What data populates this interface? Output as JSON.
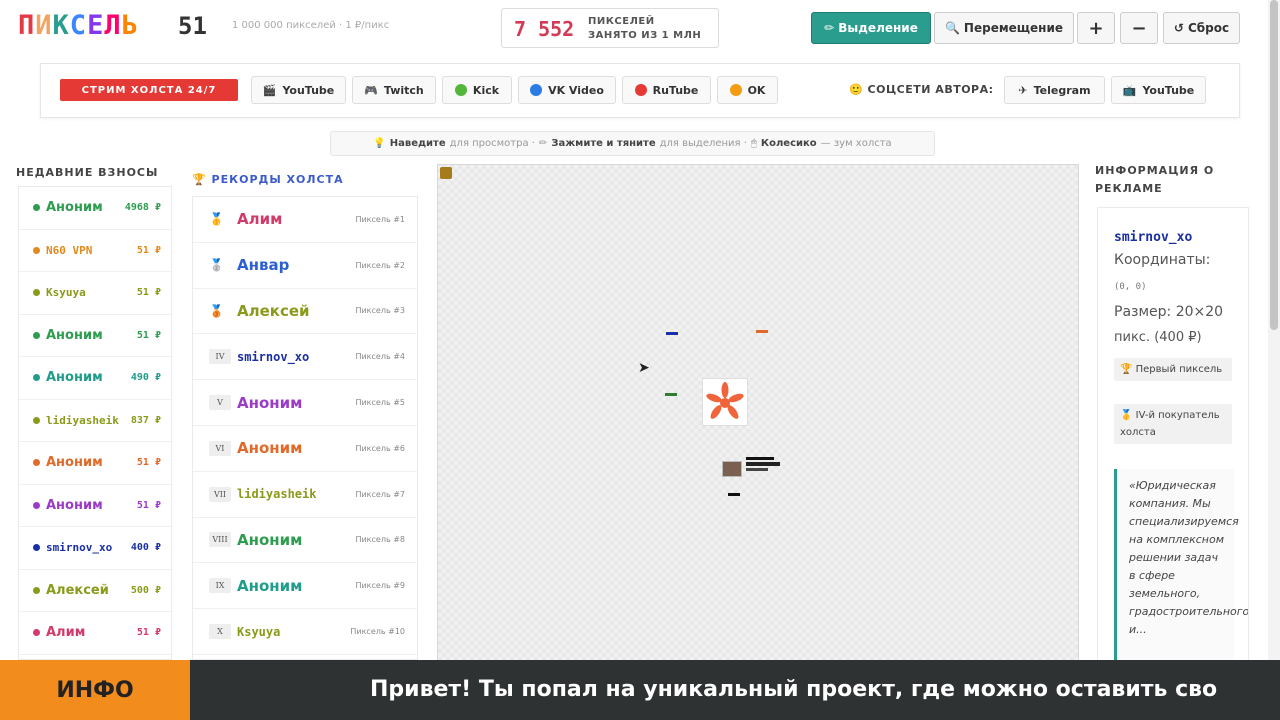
{
  "header": {
    "logo_letters": [
      {
        "ch": "П",
        "color": "#e63946"
      },
      {
        "ch": "И",
        "color": "#f4a261"
      },
      {
        "ch": "К",
        "color": "#2a9d8f"
      },
      {
        "ch": "С",
        "color": "#3a86ff"
      },
      {
        "ch": "Е",
        "color": "#8338ec"
      },
      {
        "ch": "Л",
        "color": "#ff006e"
      },
      {
        "ch": "Ь",
        "color": "#fb8500"
      }
    ],
    "logo_number": "51",
    "subtitle": "1 000 000 пикселей · 1 ₽/пикс",
    "counter_value": "7 552",
    "counter_label_line1": "ПИКСЕЛЕЙ",
    "counter_label_line2": "ЗАНЯТО ИЗ 1 МЛН",
    "tools": {
      "select_label": "Выделение",
      "move_label": "Перемещение",
      "zoom_in_label": "+",
      "zoom_out_label": "−",
      "reset_label": "Сброс"
    }
  },
  "streams": {
    "live_label": "СТРИМ ХОЛСТА 24/7",
    "platforms": [
      {
        "label": "YouTube",
        "icon": "film-icon"
      },
      {
        "label": "Twitch",
        "icon": "gamepad-icon"
      },
      {
        "label": "Kick",
        "icon": "green-dot",
        "color": "#53b53a"
      },
      {
        "label": "VK Video",
        "icon": "blue-dot",
        "color": "#2c7be5"
      },
      {
        "label": "RuTube",
        "icon": "red-dot",
        "color": "#e53935"
      },
      {
        "label": "OK",
        "icon": "orange-dot",
        "color": "#f39c12"
      }
    ],
    "author_label": "СОЦСЕТИ АВТОРА:",
    "author_links": [
      {
        "label": "Telegram",
        "icon": "plane-icon"
      },
      {
        "label": "YouTube",
        "icon": "tv-icon"
      }
    ]
  },
  "hint": {
    "hover_bold": "Наведите",
    "hover_text": "для просмотра ·",
    "drag_bold": "Зажмите и тяните",
    "drag_text": "для выделения ·",
    "wheel_bold": "Колесико",
    "wheel_text": "— зум холста"
  },
  "recent": {
    "title": "НЕДАВНИЕ ВЗНОСЫ",
    "items": [
      {
        "name": "Аноним",
        "amount": "4968 ₽",
        "color": "#2e9d4f"
      },
      {
        "name": "N60 VPN",
        "amount": "51 ₽",
        "color": "#e08a1e"
      },
      {
        "name": "Ksyuya",
        "amount": "51 ₽",
        "color": "#8a9a1a"
      },
      {
        "name": "Аноним",
        "amount": "51 ₽",
        "color": "#2e9d4f"
      },
      {
        "name": "Аноним",
        "amount": "490 ₽",
        "color": "#1f9d8a"
      },
      {
        "name": "lidiyasheik",
        "amount": "837 ₽",
        "color": "#8a9a1a"
      },
      {
        "name": "Аноним",
        "amount": "51 ₽",
        "color": "#e06a2a"
      },
      {
        "name": "Аноним",
        "amount": "51 ₽",
        "color": "#9b3cc9"
      },
      {
        "name": "smirnov_xo",
        "amount": "400 ₽",
        "color": "#1a2fa3"
      },
      {
        "name": "Алексей",
        "amount": "500 ₽",
        "color": "#8a9a1a"
      },
      {
        "name": "Алим",
        "amount": "51 ₽",
        "color": "#d23a6a"
      }
    ]
  },
  "records": {
    "title": "РЕКОРДЫ ХОЛСТА",
    "items": [
      {
        "rank": "🥇",
        "roman": false,
        "name": "Алим",
        "note": "Пиксель #1",
        "color": "#d23a6a"
      },
      {
        "rank": "🥈",
        "roman": false,
        "name": "Анвар",
        "note": "Пиксель #2",
        "color": "#2c5fd1"
      },
      {
        "rank": "🥉",
        "roman": false,
        "name": "Алексей",
        "note": "Пиксель #3",
        "color": "#8a9a1a"
      },
      {
        "rank": "IV",
        "roman": true,
        "name": "smirnov_xo",
        "note": "Пиксель #4",
        "color": "#1a2fa3"
      },
      {
        "rank": "V",
        "roman": true,
        "name": "Аноним",
        "note": "Пиксель #5",
        "color": "#9b3cc9"
      },
      {
        "rank": "VI",
        "roman": true,
        "name": "Аноним",
        "note": "Пиксель #6",
        "color": "#e06a2a"
      },
      {
        "rank": "VII",
        "roman": true,
        "name": "lidiyasheik",
        "note": "Пиксель #7",
        "color": "#8a9a1a"
      },
      {
        "rank": "VIII",
        "roman": true,
        "name": "Аноним",
        "note": "Пиксель #8",
        "color": "#2e9d4f"
      },
      {
        "rank": "IX",
        "roman": true,
        "name": "Аноним",
        "note": "Пиксель #9",
        "color": "#1f9d8a"
      },
      {
        "rank": "X",
        "roman": true,
        "name": "Ksyuya",
        "note": "Пиксель #10",
        "color": "#8a9a1a"
      }
    ]
  },
  "ad": {
    "title": "ИНФОРМАЦИЯ О РЕКЛАМЕ",
    "owner": "smirnov_xo",
    "coords_label": "Координаты:",
    "coords_value": "(0, 0)",
    "size_label": "Размер: 20×20",
    "size_value": "пикс. (400 ₽)",
    "badge1": "🏆 Первый пиксель",
    "badge2": "🥇 IV-й покупатель холста",
    "quote": "«Юридическая компания. Мы специализируемся на комплексном решении задач в сфере земельного, градостроительного и..."
  },
  "ticker": {
    "tag": "ИНФО",
    "text": "Привет! Ты попал на уникальный проект, где можно оставить сво"
  }
}
